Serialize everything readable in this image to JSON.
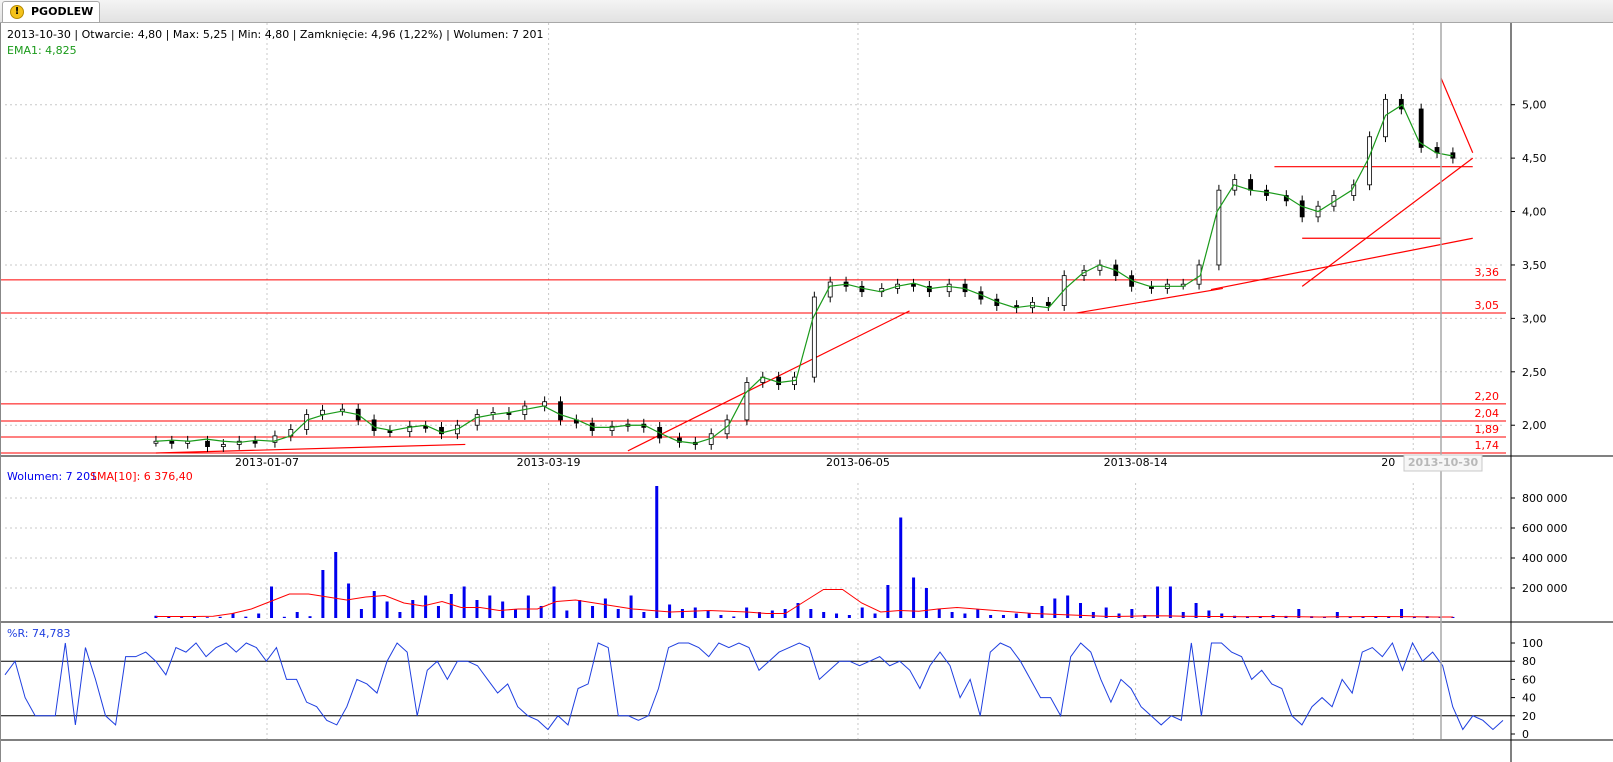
{
  "tab": {
    "label": "PGODLEW",
    "icon": "warning-icon"
  },
  "info": {
    "ohlc": "2013-10-30 | Otwarcie: 4,80 | Max: 5,25 | Min: 4,80 | Zamknięcie: 4,96 (1,22%) | Wolumen: 7 201",
    "ema": "EMA1: 4,825",
    "volume": "Wolumen: 7 201",
    "sma": "SMA[10]: 6 376,40",
    "wr": "%R: 74,783"
  },
  "colors": {
    "ema": "#1a9a1a",
    "trend": "#ff0000",
    "volume": "#0000ee",
    "sma": "#ff0000",
    "wr": "#1f3fe0",
    "grid": "#c8c8c8"
  },
  "chart_data": [
    {
      "type": "candlestick",
      "y_ticks": [
        "5,00",
        "4,50",
        "4,00",
        "3,50",
        "3,00",
        "2,50",
        "2,00"
      ],
      "x_ticks": [
        "2013-01-07",
        "2013-03-19",
        "2013-06-05",
        "2013-08-14",
        "20"
      ],
      "cursor_label": "2013-10-30",
      "ylim": [
        1.7,
        5.3
      ],
      "levels": [
        {
          "value": 3.36,
          "label": "3,36"
        },
        {
          "value": 3.05,
          "label": "3,05"
        },
        {
          "value": 2.2,
          "label": "2,20"
        },
        {
          "value": 2.04,
          "label": "2,04"
        },
        {
          "value": 1.89,
          "label": "1,89"
        },
        {
          "value": 1.74,
          "label": "1,74"
        }
      ],
      "series": [
        {
          "name": "EMA1",
          "values": [
            1.85,
            1.86,
            1.85,
            1.87,
            1.85,
            1.84,
            1.86,
            1.85,
            1.9,
            2.05,
            2.1,
            2.13,
            2.1,
            1.98,
            1.95,
            1.98,
            2.0,
            1.93,
            1.97,
            2.07,
            2.1,
            2.12,
            2.15,
            2.18,
            2.1,
            2.05,
            1.98,
            1.98,
            2.0,
            2.0,
            1.92,
            1.85,
            1.83,
            1.88,
            2.0,
            2.3,
            2.45,
            2.4,
            2.42,
            3.0,
            3.3,
            3.32,
            3.28,
            3.25,
            3.3,
            3.33,
            3.28,
            3.3,
            3.28,
            3.22,
            3.15,
            3.1,
            3.12,
            3.1,
            3.28,
            3.42,
            3.5,
            3.45,
            3.35,
            3.3,
            3.3,
            3.3,
            3.4,
            4.0,
            4.25,
            4.2,
            4.18,
            4.15,
            4.05,
            4.0,
            4.1,
            4.2,
            4.5,
            4.9,
            5.0,
            4.65,
            4.55,
            4.52
          ]
        },
        {
          "name": "",
          "values": [
            1.85,
            1.83,
            1.85,
            1.8,
            1.82,
            1.85,
            1.84,
            1.9,
            1.96,
            2.1,
            2.14,
            2.15,
            2.05,
            1.95,
            1.94,
            1.99,
            1.98,
            1.92,
            2.0,
            2.1,
            2.12,
            2.1,
            2.18,
            2.22,
            2.05,
            2.02,
            1.95,
            1.99,
            2.01,
            1.98,
            1.88,
            1.84,
            1.82,
            1.92,
            2.05,
            2.4,
            2.45,
            2.38,
            2.45,
            3.2,
            3.34,
            3.3,
            3.25,
            3.28,
            3.32,
            3.3,
            3.25,
            3.32,
            3.25,
            3.18,
            3.12,
            3.1,
            3.15,
            3.12,
            3.4,
            3.45,
            3.5,
            3.4,
            3.3,
            3.28,
            3.32,
            3.32,
            3.5,
            4.2,
            4.3,
            4.2,
            4.15,
            4.1,
            3.95,
            4.05,
            4.15,
            4.25,
            4.7,
            5.05,
            4.96,
            4.6,
            4.55,
            4.5
          ]
        }
      ],
      "trendlines": [
        {
          "from": [
            "2012-12-10",
            1.74
          ],
          "to": [
            "2013-02-26",
            1.82
          ]
        },
        {
          "from": [
            "2013-04-08",
            1.76
          ],
          "to": [
            "2013-06-18",
            3.07
          ]
        },
        {
          "from": [
            "2013-07-30",
            3.05
          ],
          "to": [
            "2013-09-05",
            3.28
          ]
        },
        {
          "from": [
            "2013-09-02",
            3.27
          ],
          "to": [
            "2013-11-07",
            3.75
          ]
        },
        {
          "from": [
            "2013-09-25",
            3.75
          ],
          "to": [
            "2013-10-30",
            3.75
          ]
        },
        {
          "from": [
            "2013-09-18",
            4.42
          ],
          "to": [
            "2013-11-07",
            4.42
          ]
        },
        {
          "from": [
            "2013-09-25",
            3.3
          ],
          "to": [
            "2013-11-07",
            4.5
          ]
        },
        {
          "from": [
            "2013-10-30",
            5.25
          ],
          "to": [
            "2013-11-07",
            4.55
          ]
        }
      ]
    },
    {
      "type": "bar",
      "y_ticks": [
        "800 000",
        "600 000",
        "400 000",
        "200 000"
      ],
      "ylim": [
        0,
        900000
      ],
      "series": [
        {
          "name": "Wolumen",
          "values": [
            15000,
            8000,
            6000,
            12000,
            5000,
            8000,
            30000,
            9000,
            30000,
            210000,
            8000,
            40000,
            12000,
            320000,
            440000,
            230000,
            60000,
            180000,
            110000,
            40000,
            120000,
            150000,
            80000,
            160000,
            210000,
            120000,
            150000,
            110000,
            60000,
            150000,
            80000,
            210000,
            50000,
            120000,
            80000,
            130000,
            60000,
            150000,
            40000,
            880000,
            90000,
            60000,
            70000,
            50000,
            20000,
            10000,
            70000,
            40000,
            50000,
            60000,
            100000,
            60000,
            40000,
            30000,
            20000,
            70000,
            30000,
            220000,
            670000,
            270000,
            200000,
            60000,
            40000,
            30000,
            60000,
            20000,
            20000,
            30000,
            30000,
            80000,
            130000,
            150000,
            100000,
            40000,
            70000,
            30000,
            60000,
            20000,
            210000,
            210000,
            40000,
            100000,
            50000,
            30000,
            15000,
            12000,
            10000,
            20000,
            14000,
            60000,
            12000,
            10000,
            40000,
            10000,
            10000,
            8000,
            12000,
            60000,
            10000,
            12000,
            10000,
            7201
          ]
        },
        {
          "name": "SMA[10]",
          "values": [
            10000,
            10000,
            10000,
            12000,
            30000,
            60000,
            110000,
            160000,
            160000,
            140000,
            120000,
            140000,
            150000,
            100000,
            80000,
            110000,
            70000,
            70000,
            50000,
            60000,
            60000,
            110000,
            120000,
            100000,
            80000,
            60000,
            50000,
            40000,
            45000,
            50000,
            45000,
            40000,
            30000,
            30000,
            110000,
            190000,
            190000,
            100000,
            40000,
            50000,
            45000,
            60000,
            70000,
            60000,
            50000,
            40000,
            30000,
            25000,
            20000,
            15000,
            10000,
            12000,
            15000,
            14000,
            12000,
            10000,
            10000,
            8000,
            10000,
            9000,
            8000,
            7000,
            8000,
            9000,
            10000,
            9000,
            8000,
            7000,
            6376
          ]
        }
      ]
    },
    {
      "type": "line",
      "y_ticks": [
        "100",
        "80",
        "60",
        "40",
        "20",
        "0"
      ],
      "ylim": [
        0,
        100
      ],
      "series": [
        {
          "name": "%R",
          "values": [
            65,
            80,
            40,
            20,
            20,
            20,
            100,
            10,
            95,
            60,
            20,
            10,
            85,
            85,
            90,
            80,
            65,
            95,
            90,
            100,
            85,
            95,
            100,
            90,
            100,
            95,
            80,
            95,
            60,
            60,
            35,
            30,
            15,
            10,
            30,
            60,
            55,
            45,
            80,
            100,
            90,
            20,
            70,
            80,
            60,
            80,
            80,
            75,
            60,
            45,
            55,
            30,
            20,
            15,
            5,
            20,
            10,
            50,
            55,
            100,
            95,
            20,
            20,
            15,
            20,
            50,
            95,
            100,
            100,
            95,
            85,
            100,
            95,
            100,
            95,
            70,
            80,
            90,
            95,
            100,
            95,
            60,
            70,
            80,
            80,
            75,
            80,
            85,
            75,
            80,
            70,
            50,
            75,
            90,
            75,
            40,
            60,
            20,
            90,
            100,
            95,
            80,
            60,
            40,
            40,
            20,
            85,
            100,
            90,
            60,
            35,
            60,
            50,
            30,
            20,
            10,
            20,
            15,
            100,
            20,
            100,
            100,
            90,
            85,
            60,
            70,
            55,
            50,
            20,
            10,
            30,
            40,
            30,
            60,
            45,
            90,
            95,
            85,
            100,
            70,
            100,
            80,
            90,
            75,
            30,
            5,
            20,
            15,
            5,
            15
          ]
        }
      ]
    }
  ]
}
